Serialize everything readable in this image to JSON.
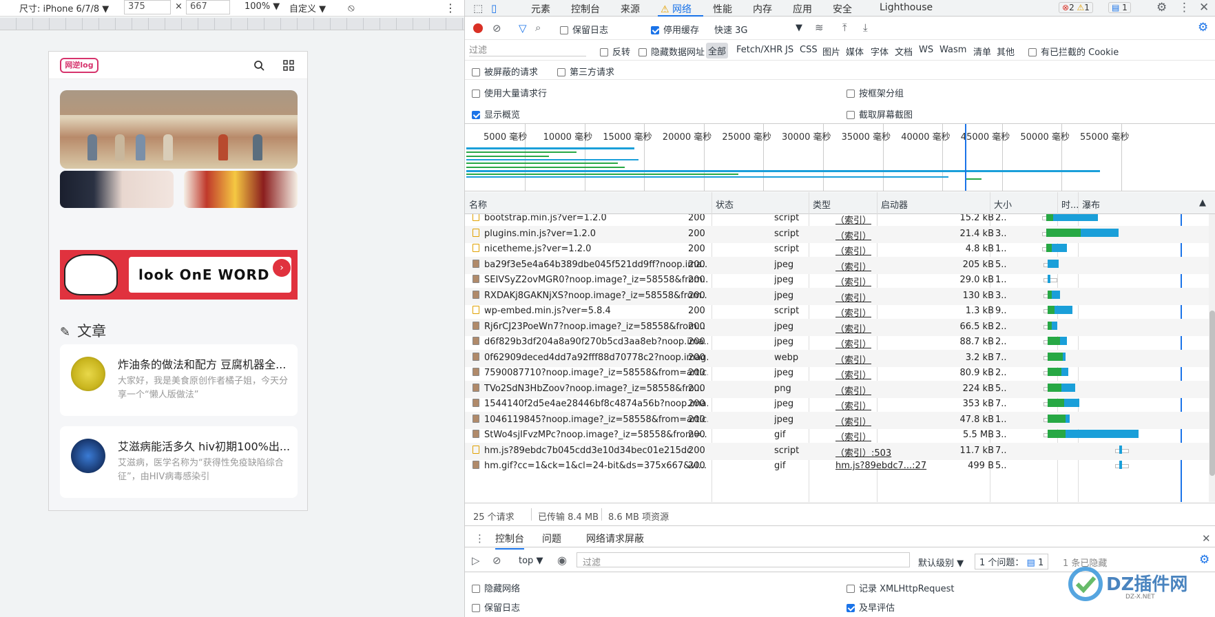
{
  "device_toolbar": {
    "device": "尺寸: iPhone 6/7/8",
    "width": "375",
    "times": "×",
    "height": "667",
    "zoom": "100%",
    "throttle": "自定义"
  },
  "phone": {
    "logo": "网逆log",
    "banner_text": "look OnE WORD",
    "section_title": "文章",
    "cards": [
      {
        "title": "炸油条的做法和配方 豆腐机器全...",
        "desc": "大家好，我是美食原创作者橘子姐，今天分享一个“懒人版做法”"
      },
      {
        "title": "艾滋病能活多久 hiv初期100%出...",
        "desc": "艾滋病，医学名称为“获得性免疫缺陷综合征”，由HIV病毒感染引"
      }
    ]
  },
  "devtools": {
    "tabs": [
      "元素",
      "控制台",
      "来源",
      "网络",
      "性能",
      "内存",
      "应用",
      "安全",
      "Lighthouse"
    ],
    "active_tab": "网络",
    "badges": {
      "errors": "2",
      "warnings": "1",
      "messages": "1"
    },
    "toolbar": {
      "preserve_log": "保留日志",
      "disable_cache": "停用缓存",
      "throttle": "快速 3G"
    },
    "filter": {
      "placeholder": "过滤",
      "invert": "反转",
      "hide_data_urls": "隐藏数据网址",
      "types": [
        "全部",
        "Fetch/XHR",
        "JS",
        "CSS",
        "图片",
        "媒体",
        "字体",
        "文档",
        "WS",
        "Wasm",
        "清单",
        "其他"
      ],
      "blocked_cookies": "有已拦截的 Cookie",
      "blocked_requests": "被屏蔽的请求",
      "third_party": "第三方请求"
    },
    "options": {
      "large_rows": "使用大量请求行",
      "group_by_frame": "按框架分组",
      "show_overview": "显示概览",
      "screenshots": "截取屏幕截图"
    },
    "overview_ticks": [
      "5000 毫秒",
      "10000 毫秒",
      "15000 毫秒",
      "20000 毫秒",
      "25000 毫秒",
      "30000 毫秒",
      "35000 毫秒",
      "40000 毫秒",
      "45000 毫秒",
      "50000 毫秒",
      "55000 毫秒"
    ],
    "columns": [
      "名称",
      "状态",
      "类型",
      "启动器",
      "大小",
      "时...",
      "瀑布"
    ],
    "rows": [
      {
        "name": "bootstrap.min.js?ver=1.2.0",
        "status": "200",
        "type": "script",
        "initiator": "（索引）",
        "size": "15.2 kB",
        "time": "2...",
        "icon": "script"
      },
      {
        "name": "plugins.min.js?ver=1.2.0",
        "status": "200",
        "type": "script",
        "initiator": "（索引）",
        "size": "21.4 kB",
        "time": "3...",
        "icon": "script"
      },
      {
        "name": "nicetheme.js?ver=1.2.0",
        "status": "200",
        "type": "script",
        "initiator": "（索引）",
        "size": "4.8 kB",
        "time": "1...",
        "icon": "script"
      },
      {
        "name": "ba29f3e5e4a64b389dbe045f521dd9ff?noop.ima...",
        "status": "200",
        "type": "jpeg",
        "initiator": "（索引）",
        "size": "205 kB",
        "time": "5...",
        "icon": "img"
      },
      {
        "name": "SEIVSyZ2ovMGR0?noop.image?_iz=58558&from...",
        "status": "200",
        "type": "jpeg",
        "initiator": "（索引）",
        "size": "29.0 kB",
        "time": "1...",
        "icon": "img"
      },
      {
        "name": "RXDAKj8GAKNjXS?noop.image?_iz=58558&from...",
        "status": "200",
        "type": "jpeg",
        "initiator": "（索引）",
        "size": "130 kB",
        "time": "3...",
        "icon": "img"
      },
      {
        "name": "wp-embed.min.js?ver=5.8.4",
        "status": "200",
        "type": "script",
        "initiator": "（索引）",
        "size": "1.3 kB",
        "time": "9...",
        "icon": "script"
      },
      {
        "name": "Rj6rCJ23PoeWn7?noop.image?_iz=58558&from...",
        "status": "200",
        "type": "jpeg",
        "initiator": "（索引）",
        "size": "66.5 kB",
        "time": "2...",
        "icon": "img"
      },
      {
        "name": "d6f829b3df204a8a90f270b5cd3aa8eb?noop.ima...",
        "status": "200",
        "type": "jpeg",
        "initiator": "（索引）",
        "size": "88.7 kB",
        "time": "2...",
        "icon": "img"
      },
      {
        "name": "0f62909deced4dd7a92fff88d70778c2?noop.imag...",
        "status": "200",
        "type": "webp",
        "initiator": "（索引）",
        "size": "3.2 kB",
        "time": "7...",
        "icon": "img"
      },
      {
        "name": "7590087710?noop.image?_iz=58558&from=artic...",
        "status": "200",
        "type": "jpeg",
        "initiator": "（索引）",
        "size": "80.9 kB",
        "time": "2...",
        "icon": "img"
      },
      {
        "name": "TVo2SdN3HbZoov?noop.image?_iz=58558&fro...",
        "status": "200",
        "type": "png",
        "initiator": "（索引）",
        "size": "224 kB",
        "time": "5...",
        "icon": "img"
      },
      {
        "name": "1544140f2d5e4ae28446bf8c4874a56b?noop.ima...",
        "status": "200",
        "type": "jpeg",
        "initiator": "（索引）",
        "size": "353 kB",
        "time": "7...",
        "icon": "img"
      },
      {
        "name": "1046119845?noop.image?_iz=58558&from=artic...",
        "status": "200",
        "type": "jpeg",
        "initiator": "（索引）",
        "size": "47.8 kB",
        "time": "1...",
        "icon": "img"
      },
      {
        "name": "StWo4sjIFvzMPc?noop.image?_iz=58558&from=...",
        "status": "200",
        "type": "gif",
        "initiator": "（索引）",
        "size": "5.5 MB",
        "time": "3...",
        "icon": "img"
      },
      {
        "name": "hm.js?89ebdc7b045cdd3e10d34bec01e215dc",
        "status": "200",
        "type": "script",
        "initiator": "（索引）:503",
        "size": "11.7 kB",
        "time": "7...",
        "icon": "script"
      },
      {
        "name": "hm.gif?cc=1&ck=1&cl=24-bit&ds=375x667&vl...",
        "status": "200",
        "type": "gif",
        "initiator": "hm.js?89ebdc7...:27",
        "size": "499 B",
        "time": "5...",
        "icon": "img"
      }
    ],
    "summary": {
      "requests": "25 个请求",
      "transferred": "已传输 8.4 MB",
      "resources": "8.6 MB 项资源"
    },
    "drawer": {
      "tabs": [
        "控制台",
        "问题",
        "网络请求屏蔽"
      ],
      "context": "top",
      "filter_placeholder": "过滤",
      "levels": "默认级别",
      "issues": "1 个问题：",
      "issues_count": "1",
      "hidden": "1 条已隐藏",
      "hide_network": "隐藏网络",
      "log_xhr": "记录 XMLHttpRequest",
      "preserve_log": "保留日志",
      "eager_eval": "及早评估"
    }
  },
  "watermark": {
    "brand": "DZ插件网",
    "url": "DZ-X.NET"
  }
}
